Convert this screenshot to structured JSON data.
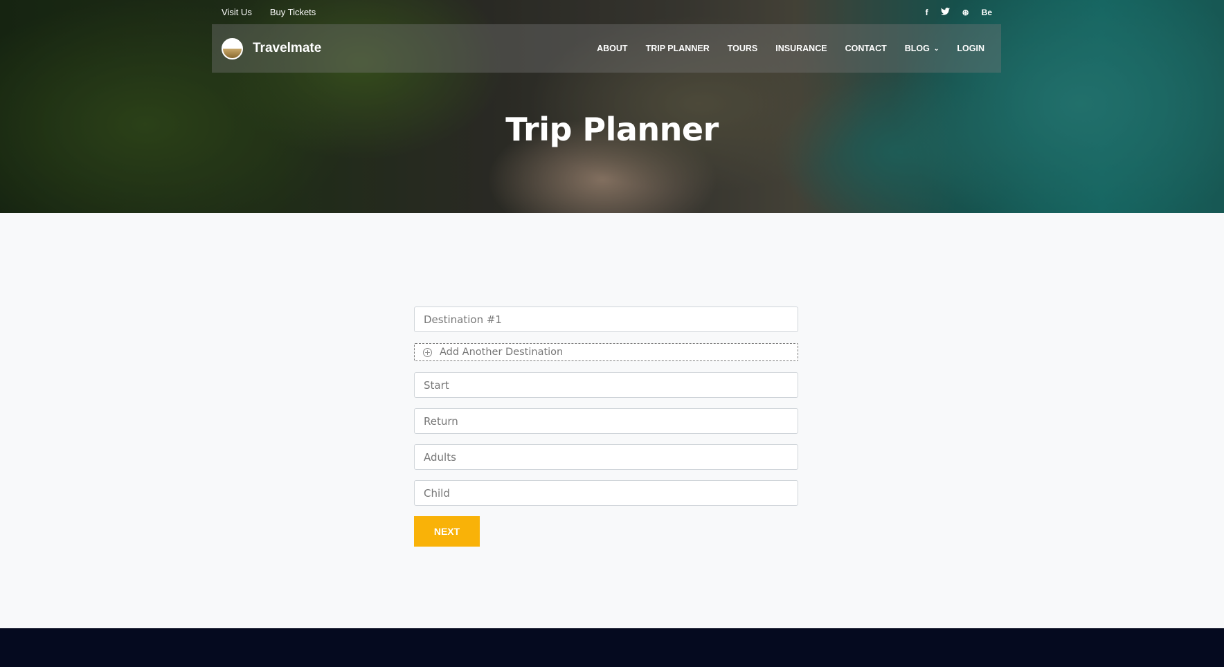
{
  "topbar": {
    "visit_us": "Visit Us",
    "buy_tickets": "Buy Tickets",
    "socials": {
      "facebook": "f",
      "twitter": "🐦",
      "dribbble": "⊛",
      "behance": "Be"
    }
  },
  "nav": {
    "brand": "Travelmate",
    "items": [
      "ABOUT",
      "TRIP PLANNER",
      "TOURS",
      "INSURANCE",
      "CONTACT",
      "BLOG"
    ],
    "blog_chevron": "⌄",
    "login": "LOGIN"
  },
  "hero": {
    "title": "Trip Planner"
  },
  "form": {
    "destination_placeholder": "Destination #1",
    "add_destination": "Add Another Destination",
    "start_placeholder": "Start",
    "return_placeholder": "Return",
    "adults_placeholder": "Adults",
    "child_placeholder": "Child",
    "next_label": "NEXT"
  },
  "colors": {
    "accent": "#f9b208",
    "footer": "#050a1f",
    "page_bg": "#f8f9fa"
  }
}
